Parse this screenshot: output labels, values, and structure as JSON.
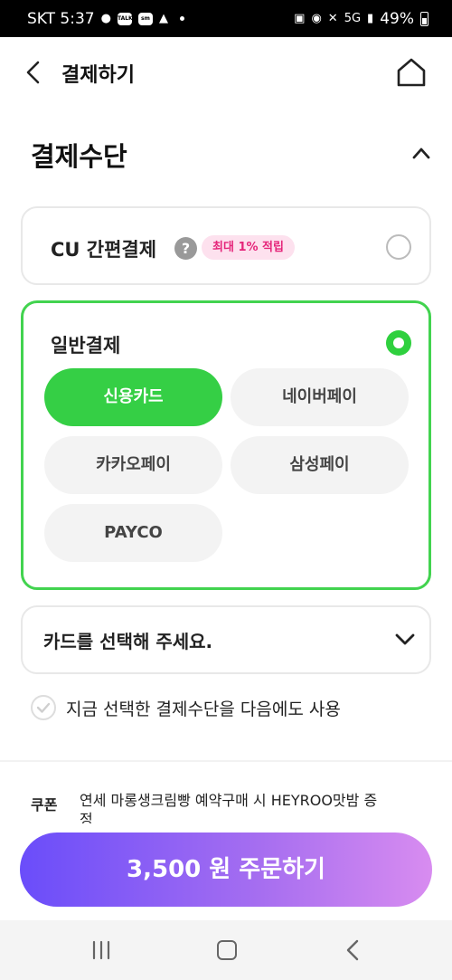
{
  "status_bar": {
    "carrier_time": "SKT 5:37",
    "app_icons": [
      "chat-bubble-icon",
      "talk-icon",
      "smart-icon",
      "game-icon"
    ],
    "signal": "5G",
    "battery": "49%"
  },
  "header": {
    "title": "결제하기",
    "back_icon": "back-arrow-icon",
    "home_icon": "home-icon"
  },
  "payment_method": {
    "section_title": "결제수단",
    "cu_easy_pay": {
      "label": "CU 간편결제",
      "help": "?",
      "badge": "최대 1% 적립",
      "selected": false
    },
    "general_pay": {
      "label": "일반결제",
      "selected": true,
      "options": [
        {
          "label": "신용카드",
          "selected": true
        },
        {
          "label": "네이버페이",
          "selected": false
        },
        {
          "label": "카카오페이",
          "selected": false
        },
        {
          "label": "삼성페이",
          "selected": false
        },
        {
          "label": "PAYCO",
          "selected": false
        }
      ]
    },
    "card_select": {
      "placeholder": "카드를 선택해 주세요."
    },
    "save_method": {
      "label": "지금 선택한 결제수단을 다음에도 사용",
      "checked": false
    }
  },
  "coupon": {
    "title": "쿠폰",
    "description": "연세 마롱생크림빵 예약구매 시 HEYROO맛밤 증정"
  },
  "order_button": {
    "label": "3,500 원 주문하기"
  },
  "colors": {
    "accent_green": "#35cf45",
    "badge_pink": "#e5257a",
    "order_gradient_start": "#6a4dfa",
    "order_gradient_end": "#d88cf0"
  }
}
